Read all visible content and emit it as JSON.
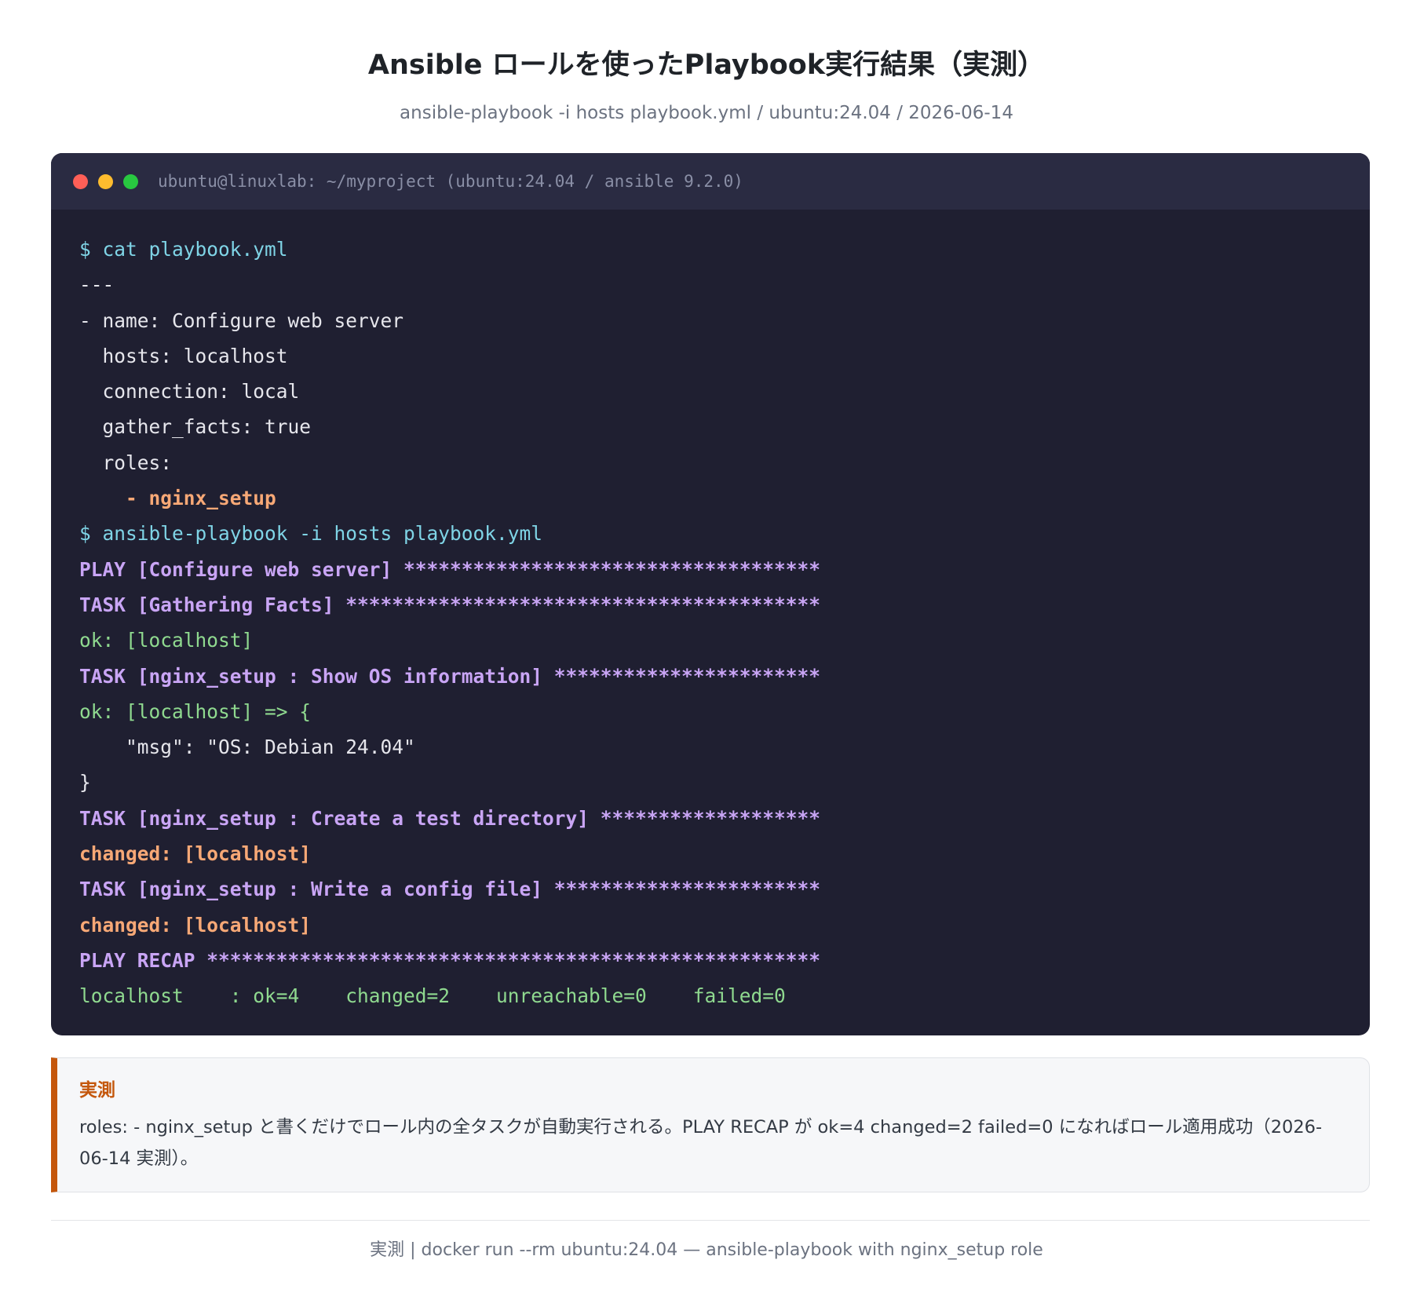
{
  "header": {
    "title": "Ansible ロールを使ったPlaybook実行結果（実測）",
    "subtitle": "ansible-playbook -i hosts playbook.yml / ubuntu:24.04 / 2026-06-14"
  },
  "terminal": {
    "window_title": "ubuntu@linuxlab: ~/myproject (ubuntu:24.04 / ansible 9.2.0)",
    "window_buttons": [
      {
        "name": "close",
        "color": "#ff5f57"
      },
      {
        "name": "minimize",
        "color": "#febc2e"
      },
      {
        "name": "maximize",
        "color": "#28c840"
      }
    ],
    "lines": [
      {
        "kind": "cmd",
        "text": "$ cat playbook.yml"
      },
      {
        "kind": "text",
        "text": "---"
      },
      {
        "kind": "text",
        "text": "- name: Configure web server"
      },
      {
        "kind": "text",
        "text": "  hosts: localhost"
      },
      {
        "kind": "text",
        "text": "  connection: local"
      },
      {
        "kind": "text",
        "text": "  gather_facts: true"
      },
      {
        "kind": "text",
        "text": "  roles:"
      },
      {
        "kind": "role",
        "text": "    - nginx_setup"
      },
      {
        "kind": "cmd",
        "text": "$ ansible-playbook -i hosts playbook.yml"
      },
      {
        "kind": "head",
        "text": "PLAY [Configure web server] ************************************"
      },
      {
        "kind": "head",
        "text": "TASK [Gathering Facts] *****************************************"
      },
      {
        "kind": "ok",
        "text": "ok: [localhost]"
      },
      {
        "kind": "head",
        "text": "TASK [nginx_setup : Show OS information] ***********************"
      },
      {
        "kind": "ok",
        "text": "ok: [localhost] => {"
      },
      {
        "kind": "text",
        "text": "    \"msg\": \"OS: Debian 24.04\""
      },
      {
        "kind": "text",
        "text": "}"
      },
      {
        "kind": "head",
        "text": "TASK [nginx_setup : Create a test directory] *******************"
      },
      {
        "kind": "changed",
        "text": "changed: [localhost]"
      },
      {
        "kind": "head",
        "text": "TASK [nginx_setup : Write a config file] ***********************"
      },
      {
        "kind": "changed",
        "text": "changed: [localhost]"
      },
      {
        "kind": "head",
        "text": "PLAY RECAP *****************************************************"
      },
      {
        "kind": "ok",
        "text": "localhost    : ok=4    changed=2    unreachable=0    failed=0"
      }
    ]
  },
  "note": {
    "label": "実測",
    "text": "roles: - nginx_setup と書くだけでロール内の全タスクが自動実行される。PLAY RECAP が ok=4 changed=2 failed=0 になればロール適用成功（2026-06-14 実測）。"
  },
  "footer": {
    "text": "実測 | docker run --rm ubuntu:24.04 — ansible-playbook with nginx_setup role"
  }
}
